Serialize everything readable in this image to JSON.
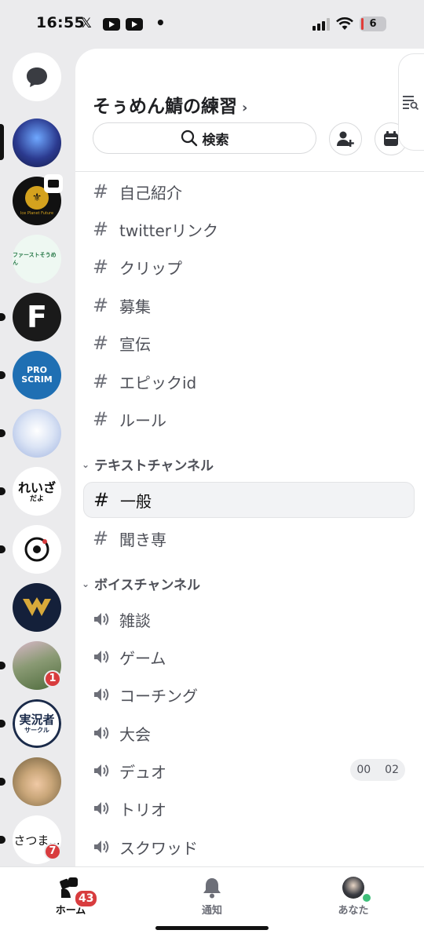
{
  "status_bar": {
    "time": "16:55",
    "x_icon": "𝕏",
    "dot": "•",
    "battery": "6"
  },
  "rail": {
    "guilds": [
      {
        "name": "guild-1",
        "color": "#2b3a8f"
      },
      {
        "name": "guild-2",
        "color": "#111111"
      },
      {
        "name": "guild-3",
        "color": "#a8d8c0"
      },
      {
        "name": "guild-4",
        "color": "#1a1a1a"
      },
      {
        "name": "guild-5",
        "color": "#1f6fb3"
      },
      {
        "name": "guild-6",
        "color": "#dbe4f5"
      },
      {
        "name": "guild-7",
        "color": "#ffffff"
      },
      {
        "name": "guild-8",
        "color": "#ffffff"
      },
      {
        "name": "guild-9",
        "color": "#1b2b4a"
      },
      {
        "name": "guild-10",
        "color": "#6b7a5a"
      },
      {
        "name": "guild-11",
        "color": "#ffffff"
      },
      {
        "name": "guild-12",
        "color": "#c9a679"
      },
      {
        "name": "guild-13",
        "color": "#ffffff"
      }
    ],
    "guild2_text": "Ice Planet Future",
    "guild3_text": "ファーストそうめん",
    "guild4_text": "F",
    "guild5_text": "PRO SCRIM",
    "guild7_text": "れいざ",
    "guild7_sub": "だよ",
    "guild11_text": "実況者",
    "guild11_sub": "サークル",
    "guild13_text": "さつま...",
    "badge_10": "1",
    "badge_13": "7"
  },
  "server": {
    "title": "そぅめん鯖の練習",
    "chevron": "›",
    "search_label": "検索"
  },
  "channels_top": [
    {
      "name": "自己紹介"
    },
    {
      "name": "twitterリンク"
    },
    {
      "name": "クリップ"
    },
    {
      "name": "募集"
    },
    {
      "name": "宣伝"
    },
    {
      "name": "エピックid"
    },
    {
      "name": "ルール"
    }
  ],
  "category_text": "テキストチャンネル",
  "text_channels": [
    {
      "name": "一般",
      "active": true
    },
    {
      "name": "聞き専"
    }
  ],
  "category_voice": "ボイスチャンネル",
  "voice_channels": [
    {
      "name": "雑談"
    },
    {
      "name": "ゲーム"
    },
    {
      "name": "コーチング"
    },
    {
      "name": "大会"
    },
    {
      "name": "デュオ",
      "count_a": "00",
      "count_b": "02"
    },
    {
      "name": "トリオ"
    },
    {
      "name": "スクワッド"
    }
  ],
  "tabbar": {
    "home": "ホーム",
    "home_badge": "43",
    "notifications": "通知",
    "you": "あなた"
  },
  "hash_glyph": "#"
}
